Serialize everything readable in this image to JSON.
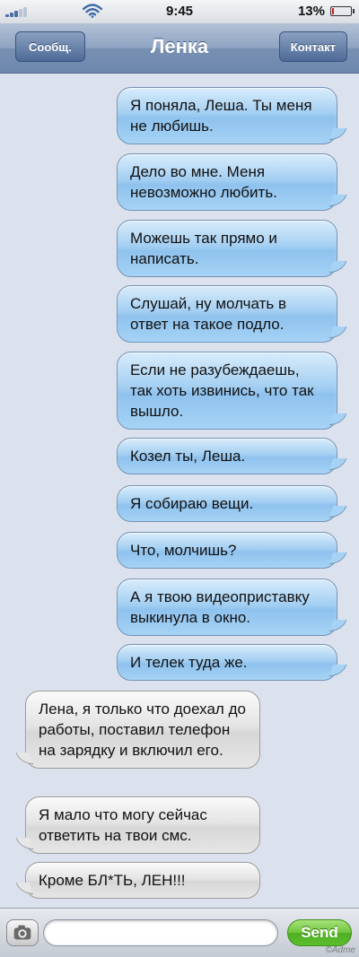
{
  "status_bar": {
    "time": "9:45",
    "battery_percent": "13%",
    "battery_level": 0.13,
    "signal_icon": "signal-bars-icon",
    "wifi_icon": "wifi-icon"
  },
  "navbar": {
    "back_label": "Сообщ.",
    "title": "Ленка",
    "contact_label": "Контакт"
  },
  "messages": [
    {
      "direction": "outgoing",
      "text": "Я поняла, Леша. Ты меня не любишь."
    },
    {
      "direction": "outgoing",
      "text": "Дело во мне. Меня невозможно любить."
    },
    {
      "direction": "outgoing",
      "text": "Можешь так прямо и написать."
    },
    {
      "direction": "outgoing",
      "text": "Слушай, ну молчать в ответ на такое подло."
    },
    {
      "direction": "outgoing",
      "text": "Если не разубеждаешь, так хоть извинись, что так вышло."
    },
    {
      "direction": "outgoing",
      "text": "Козел ты, Леша."
    },
    {
      "direction": "outgoing",
      "text": "Я собираю вещи."
    },
    {
      "direction": "outgoing",
      "text": "Что, молчишь?"
    },
    {
      "direction": "outgoing",
      "text": "А я твою видеоприставку выкинула в окно."
    },
    {
      "direction": "outgoing",
      "text": "И телек туда же."
    },
    {
      "direction": "incoming",
      "text": "Лена, я только что доехал до работы, поставил телефон на зарядку и включил его."
    },
    {
      "direction": "incoming",
      "text": "Я мало что могу сейчас ответить на твои смс."
    },
    {
      "direction": "incoming",
      "text": "Кроме БЛ*ТЬ, ЛЕН!!!"
    }
  ],
  "input_bar": {
    "camera_icon": "camera-icon",
    "send_label": "Send",
    "watermark": "©Adme"
  },
  "colors": {
    "outgoing_bubble": "#a4cff2",
    "incoming_bubble": "#e4e4e4",
    "navbar": "#8ea3c2",
    "send_button": "#6fc53b"
  }
}
